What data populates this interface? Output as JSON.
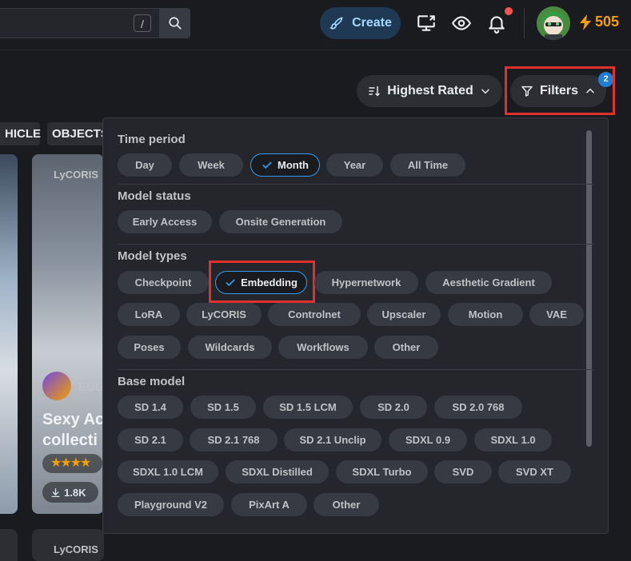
{
  "header": {
    "search_shortcut": "/",
    "create_label": "Create",
    "buzz_amount": "505"
  },
  "toolbar": {
    "sort_label": "Highest Rated",
    "filters_label": "Filters",
    "filters_count": "2"
  },
  "categories": [
    "HICLE",
    "OBJECTS"
  ],
  "background_cards": {
    "card_type_top": "LyCORIS",
    "card_type_bottom": "LyCORIS",
    "creator_fragment": "EDG",
    "title_line1": "Sexy Ac",
    "title_line2": "collecti",
    "downloads": "1.8K"
  },
  "filters_panel": {
    "time_period": {
      "title": "Time period",
      "options": [
        "Day",
        "Week",
        "Month",
        "Year",
        "All Time"
      ],
      "selected": "Month"
    },
    "model_status": {
      "title": "Model status",
      "options": [
        "Early Access",
        "Onsite Generation"
      ]
    },
    "model_types": {
      "title": "Model types",
      "options": [
        "Checkpoint",
        "Embedding",
        "Hypernetwork",
        "Aesthetic Gradient",
        "LoRA",
        "LyCORIS",
        "Controlnet",
        "Upscaler",
        "Motion",
        "VAE",
        "Poses",
        "Wildcards",
        "Workflows",
        "Other"
      ],
      "selected": "Embedding"
    },
    "base_model": {
      "title": "Base model",
      "options": [
        "SD 1.4",
        "SD 1.5",
        "SD 1.5 LCM",
        "SD 2.0",
        "SD 2.0 768",
        "SD 2.1",
        "SD 2.1 768",
        "SD 2.1 Unclip",
        "SDXL 0.9",
        "SDXL 1.0",
        "SDXL 1.0 LCM",
        "SDXL Distilled",
        "SDXL Turbo",
        "SVD",
        "SVD XT",
        "Playground V2",
        "PixArt A",
        "Other"
      ]
    }
  },
  "colors": {
    "accent": "#339af0",
    "highlight_box": "#e03131",
    "buzz": "#f59f00",
    "notification": "#fa5252"
  }
}
